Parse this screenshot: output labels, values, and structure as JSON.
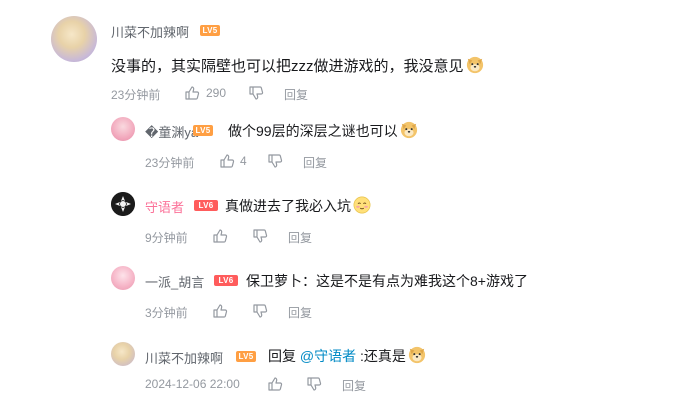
{
  "main_comment": {
    "username": "川菜不加辣啊",
    "level": "LV5",
    "text": "没事的，其实隔壁也可以把zzz做进游戏的，我没意见",
    "emoji": "doge-emoji",
    "time": "23分钟前",
    "likes": "290",
    "reply_label": "回复"
  },
  "replies": [
    {
      "username": "�童渊ya",
      "level": "LV5",
      "text": "做个99层的深层之谜也可以",
      "emoji": "doge-emoji",
      "time": "23分钟前",
      "likes": "4",
      "reply_label": "回复"
    },
    {
      "username": "守语者",
      "level": "LV6",
      "text": "真做进去了我必入坑",
      "emoji": "blush-emoji",
      "time": "9分钟前",
      "reply_label": "回复"
    },
    {
      "username": "一派_胡言",
      "level": "LV6",
      "text": "保卫萝卜：这是不是有点为难我这个8+游戏了",
      "time": "3分钟前",
      "reply_label": "回复"
    },
    {
      "username": "川菜不加辣啊",
      "level": "LV5",
      "prefix": "回复",
      "mention": "@守语者",
      "text": ":还真是",
      "emoji": "doge-emoji",
      "time": "2024-12-06 22:00",
      "reply_label": "回复"
    }
  ],
  "colors": {
    "username": "#61666d",
    "username_vip": "#fb7299",
    "mention": "#008ac5",
    "meta": "#9499a0",
    "lv5": "#ff9f43",
    "lv6": "#ff5c5c"
  }
}
